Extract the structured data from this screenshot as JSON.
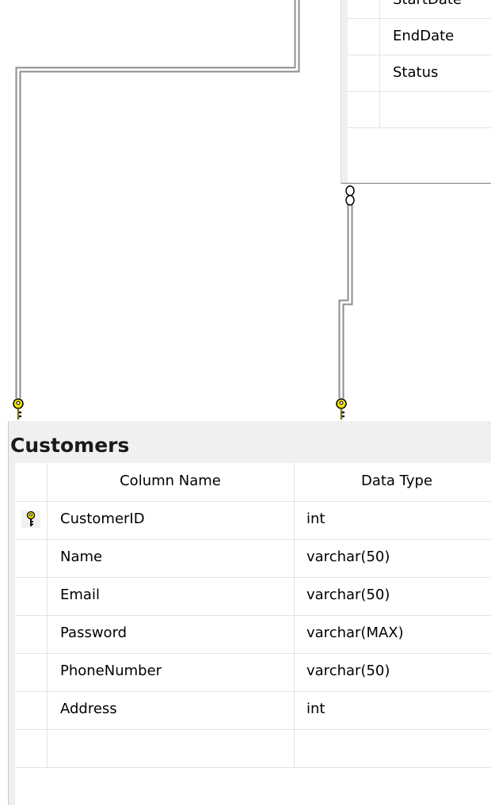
{
  "top_table": {
    "rows": [
      {
        "name": "StartDate"
      },
      {
        "name": "EndDate"
      },
      {
        "name": "Status"
      },
      {
        "name": ""
      }
    ]
  },
  "customers": {
    "title": "Customers",
    "headers": {
      "column_name": "Column Name",
      "data_type": "Data Type"
    },
    "rows": [
      {
        "name": "CustomerID",
        "type": "int",
        "primary_key": true
      },
      {
        "name": "Name",
        "type": "varchar(50)",
        "primary_key": false
      },
      {
        "name": "Email",
        "type": "varchar(50)",
        "primary_key": false
      },
      {
        "name": "Password",
        "type": "varchar(MAX)",
        "primary_key": false
      },
      {
        "name": "PhoneNumber",
        "type": "varchar(50)",
        "primary_key": false
      },
      {
        "name": "Address",
        "type": "int",
        "primary_key": false
      },
      {
        "name": "",
        "type": "",
        "primary_key": false
      }
    ]
  },
  "relationships": [
    {
      "end_top": "none",
      "end_bottom": "key-icon"
    },
    {
      "end_top": "infinity-icon",
      "end_bottom": "key-icon"
    }
  ],
  "colors": {
    "line": "#a0a0a0",
    "key_fill": "#f5e400",
    "panel_bg": "#f0f0f0"
  }
}
